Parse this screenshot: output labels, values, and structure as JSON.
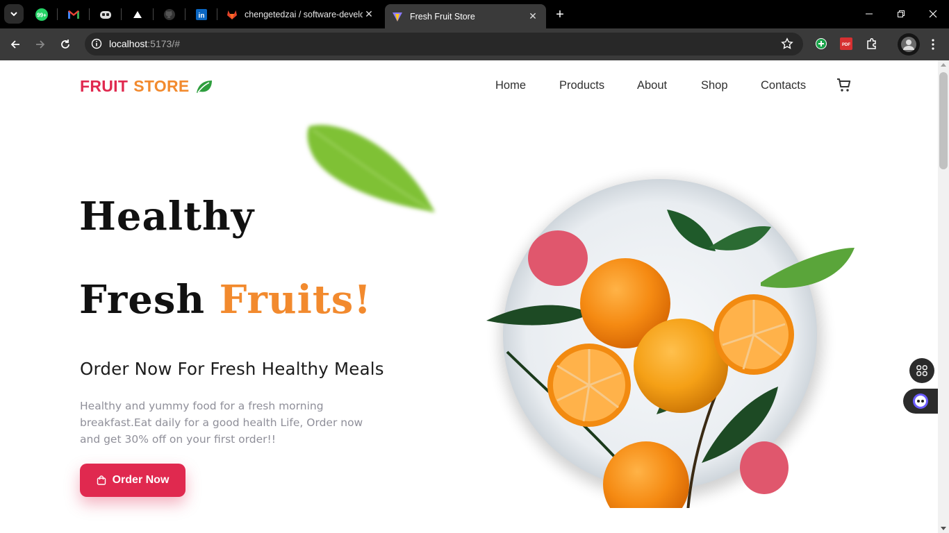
{
  "browser": {
    "tabs": [
      {
        "title": "chengetedzai / software-develo",
        "favicon": "gitlab-icon",
        "active": false
      },
      {
        "title": "Fresh Fruit Store",
        "favicon": "vite-icon",
        "active": true
      }
    ],
    "pinned_tabs": [
      "whatsapp-icon",
      "gmail-icon",
      "copilot-icon",
      "vercel-icon",
      "github-icon",
      "linkedin-icon"
    ],
    "whatsapp_badge": "99+",
    "url_host": "localhost",
    "url_rest": ":5173/#",
    "extension_pdf_label": "PDF"
  },
  "page": {
    "logo": {
      "word1": "FRUIT",
      "word2": "STORE",
      "icon": "leaf-icon"
    },
    "nav": [
      {
        "label": "Home"
      },
      {
        "label": "Products"
      },
      {
        "label": "About"
      },
      {
        "label": "Shop"
      },
      {
        "label": "Contacts"
      }
    ],
    "hero": {
      "line1": "Healthy",
      "line2_a": "Fresh",
      "line2_b": "Fruits!",
      "subtitle": "Order Now For Fresh Healthy Meals",
      "description": "Healthy and yummy food for a fresh morning breakfast.Eat daily for a good health Life, Order now and get 30% off on your first order!!",
      "button": "Order Now"
    },
    "colors": {
      "accent_red": "#e0294f",
      "accent_orange": "#f28a2e",
      "leaf_green": "#2e9e3e"
    }
  }
}
